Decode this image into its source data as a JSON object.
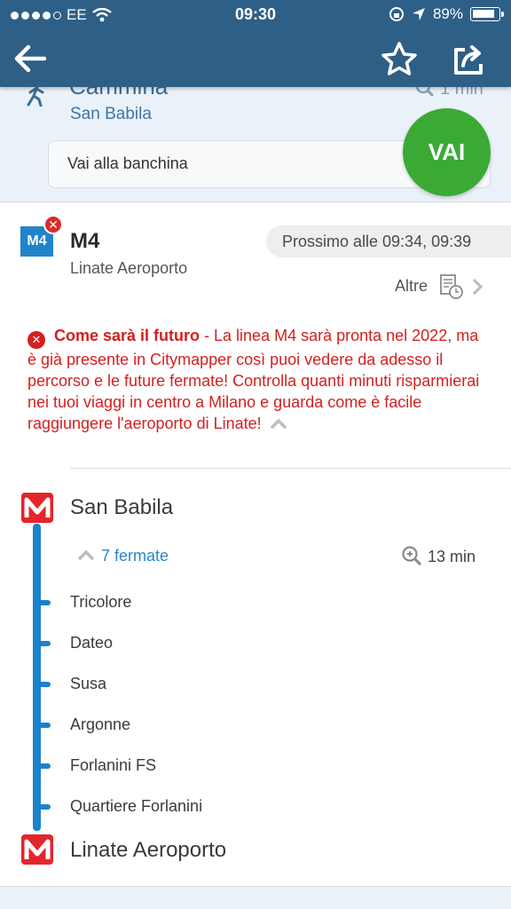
{
  "status_bar": {
    "carrier": "EE",
    "time": "09:30",
    "battery": "89%",
    "battery_level": 0.89
  },
  "nav": {
    "back": "back-arrow-icon",
    "favorite": "star-icon",
    "share": "share-icon"
  },
  "walk": {
    "title": "Cammina",
    "duration": "1 min",
    "station": "San Babila",
    "platform_button": "Vai alla banchina",
    "go_button": "VAI"
  },
  "line": {
    "badge": "M4",
    "name": "M4",
    "destination": "Linate Aeroporto",
    "next_departures": "Prossimo alle 09:34, 09:39",
    "more_label": "Altre",
    "notice_title": "Come sarà il futuro",
    "notice_body": " - La linea M4 sarà pronta nel 2022, ma è già presente in Citymapper così puoi vedere da adesso il percorso e le future fermate! Controlla quanti minuti risparmierai nei tuoi viaggi in centro a Milano e guarda come è facile raggiungere l'aeroporto di Linate!",
    "colors": {
      "line": "#1b82cb",
      "metro": "#e3262b",
      "alert": "#d42020",
      "go": "#3aaa35",
      "header": "#2e5f86"
    }
  },
  "route": {
    "origin": "San Babila",
    "stops_toggle": "7 fermate",
    "duration": "13 min",
    "stops": [
      "Tricolore",
      "Dateo",
      "Susa",
      "Argonne",
      "Forlanini FS",
      "Quartiere Forlanini"
    ],
    "destination": "Linate Aeroporto"
  }
}
